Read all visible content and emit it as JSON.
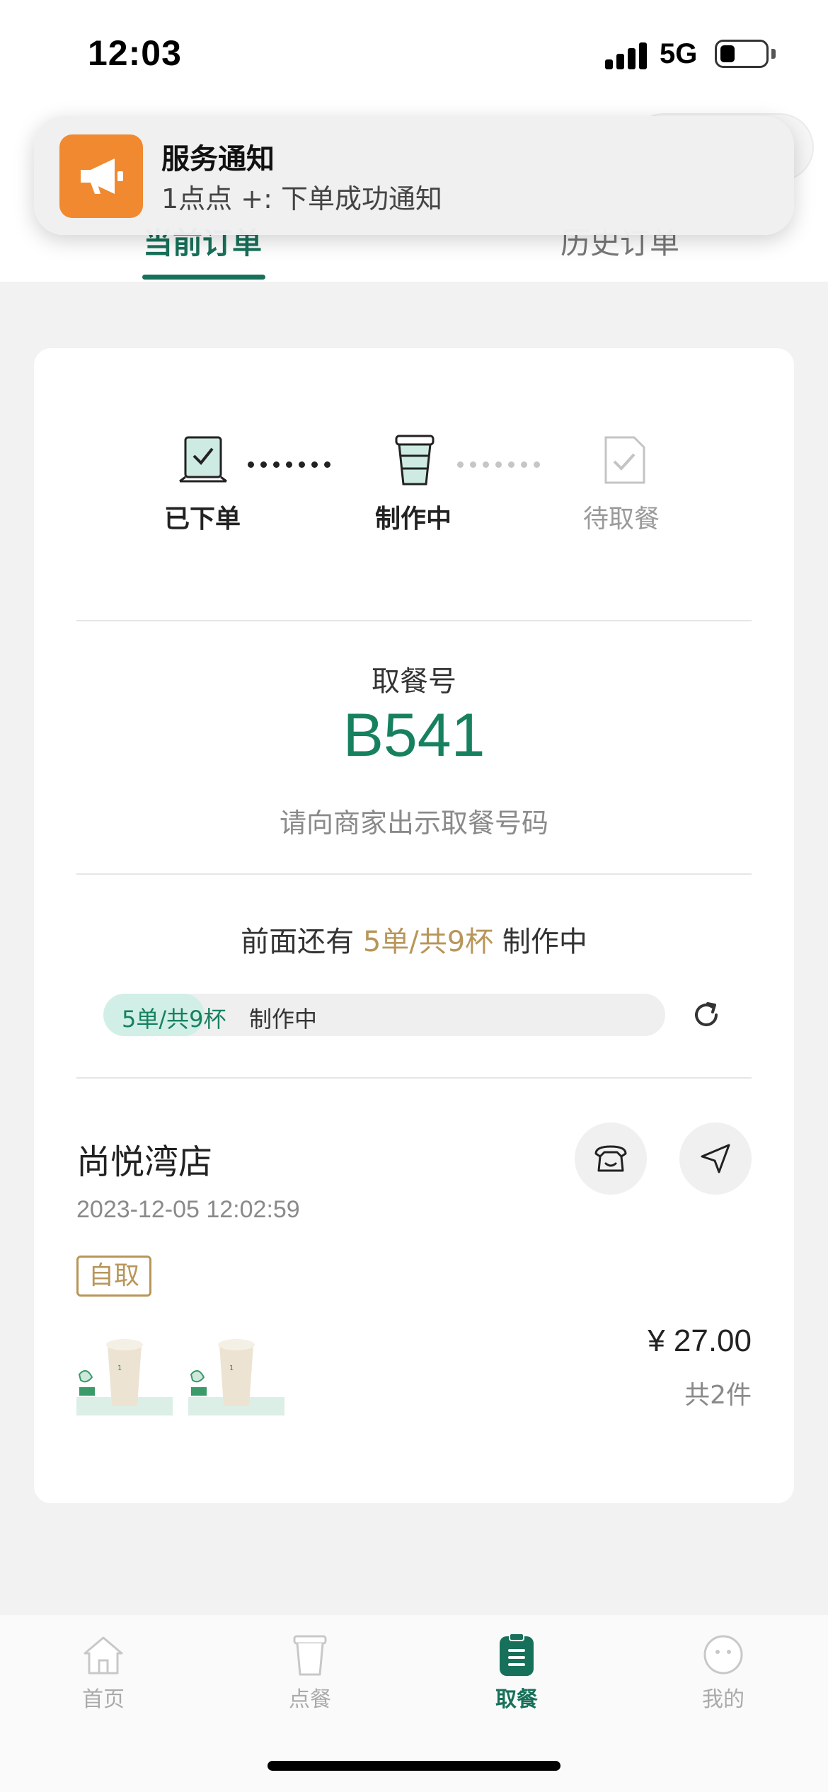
{
  "status_bar": {
    "time": "12:03",
    "network": "5G",
    "battery_level": 0.2
  },
  "tabs": [
    {
      "label": "当前订单",
      "active": true
    },
    {
      "label": "历史订单",
      "active": false
    }
  ],
  "notification": {
    "title": "服务通知",
    "body": "1点点 +: 下单成功通知",
    "icon": "megaphone-icon",
    "icon_color": "#f0892f"
  },
  "steps": [
    {
      "label": "已下单",
      "icon": "order-placed-icon",
      "state": "done"
    },
    {
      "label": "制作中",
      "icon": "cup-icon",
      "state": "current"
    },
    {
      "label": "待取餐",
      "icon": "pickup-icon",
      "state": "pending"
    }
  ],
  "pickup": {
    "label": "取餐号",
    "number": "B541",
    "hint": "请向商家出示取餐号码"
  },
  "queue": {
    "prefix": "前面还有",
    "highlight": "5单/共9杯",
    "suffix": "制作中",
    "progress_count": "5单/共9杯",
    "progress_status": "制作中",
    "progress_fraction": 0.18
  },
  "store": {
    "name": "尚悦湾店",
    "order_time": "2023-12-05 12:02:59",
    "tag": "自取",
    "price": "¥ 27.00",
    "item_count": "共2件"
  },
  "bottom_nav": [
    {
      "label": "首页",
      "icon": "home-icon",
      "active": false
    },
    {
      "label": "点餐",
      "icon": "cup-icon",
      "active": false
    },
    {
      "label": "取餐",
      "icon": "clipboard-icon",
      "active": true
    },
    {
      "label": "我的",
      "icon": "face-icon",
      "active": false
    }
  ],
  "colors": {
    "brand_green": "#17715a",
    "accent_gold": "#b8965a",
    "progress_fill": "#d1efe6"
  }
}
